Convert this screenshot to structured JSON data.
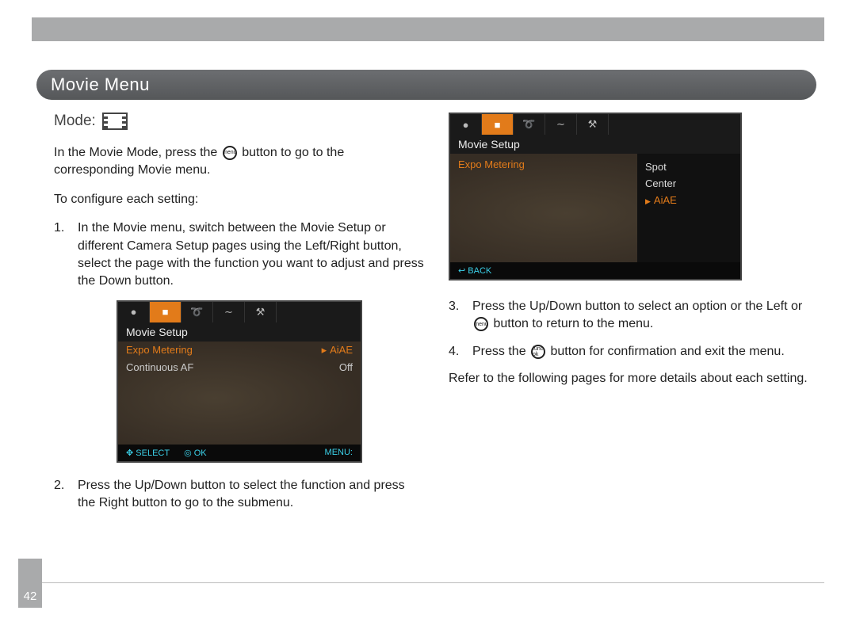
{
  "page_number": "42",
  "section_title": "Movie Menu",
  "mode_label": "Mode:",
  "intro_before": "In the Movie Mode, press the ",
  "intro_btn1": "menu",
  "intro_after": " button to go to the corresponding Movie menu.",
  "configure_heading": "To configure each setting:",
  "steps": {
    "s1_num": "1.",
    "s1": "In the Movie menu, switch between the Movie Setup or different Camera Setup pages using the Left/Right button, select the page with the function you want to adjust and press the Down button.",
    "s2_num": "2.",
    "s2": "Press the Up/Down button to select the function and press the Right button to go to the submenu.",
    "s3_num": "3.",
    "s3_before": "Press the Up/Down button to select an option or the Left or ",
    "s3_btn": "menu",
    "s3_after": " button to return to the menu.",
    "s4_num": "4.",
    "s4_before": "Press the ",
    "s4_btn": "func ok",
    "s4_after": " button for confirmation and exit the menu."
  },
  "closing": "Refer to the following pages for more details about each setting.",
  "cam1": {
    "title": "Movie Setup",
    "row1_label": "Expo Metering",
    "row1_value": "AiAE",
    "row2_label": "Continuous AF",
    "row2_value": "Off",
    "foot_select": "SELECT",
    "foot_ok": "OK",
    "foot_menu": "MENU:"
  },
  "cam2": {
    "title": "Movie Setup",
    "row_label": "Expo Metering",
    "opt1": "Spot",
    "opt2": "Center",
    "opt3": "AiAE",
    "back": "BACK"
  },
  "icons": {
    "tab_camera": "●",
    "tab_movie": "■",
    "tab_wrench": "➰",
    "tab_wave": "∼",
    "tab_tools": "⚒"
  }
}
